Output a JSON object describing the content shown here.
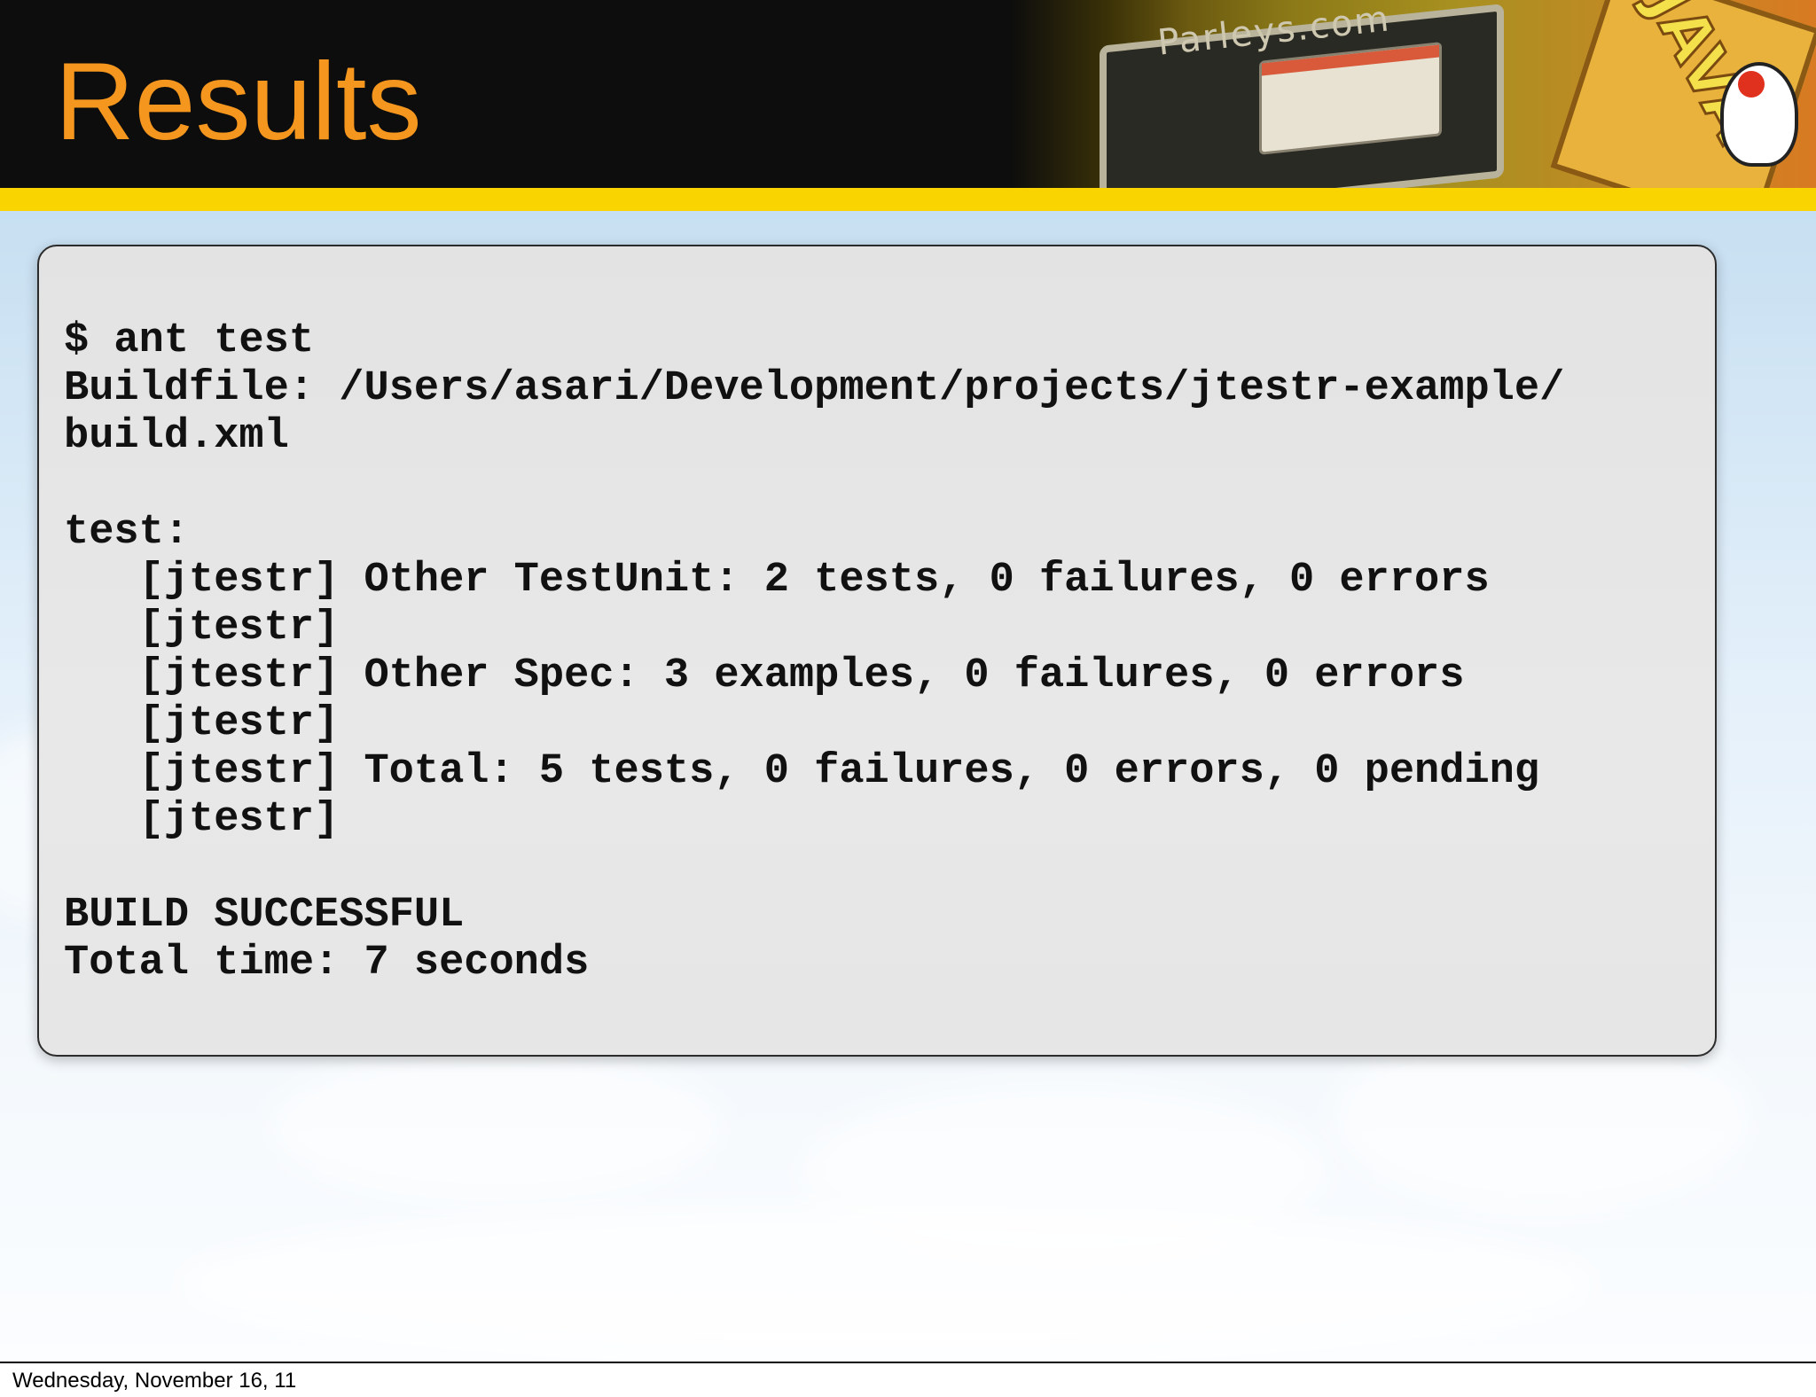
{
  "slide": {
    "title": "Results",
    "header_art_brand": "Parleys.com",
    "header_art_sign": "JAVA"
  },
  "console": {
    "lines": [
      "$ ant test",
      "Buildfile: /Users/asari/Development/projects/jtestr-example/",
      "build.xml",
      "",
      "test:",
      "   [jtestr] Other TestUnit: 2 tests, 0 failures, 0 errors",
      "   [jtestr]",
      "   [jtestr] Other Spec: 3 examples, 0 failures, 0 errors",
      "   [jtestr]",
      "   [jtestr] Total: 5 tests, 0 failures, 0 errors, 0 pending",
      "   [jtestr]",
      "",
      "BUILD SUCCESSFUL",
      "Total time: 7 seconds"
    ]
  },
  "footer": {
    "date": "Wednesday, November 16, 11"
  },
  "colors": {
    "title": "#f5961e",
    "header_bg": "#0d0d0d",
    "band": "#f9d400",
    "console_bg": "#e6e6e6"
  }
}
